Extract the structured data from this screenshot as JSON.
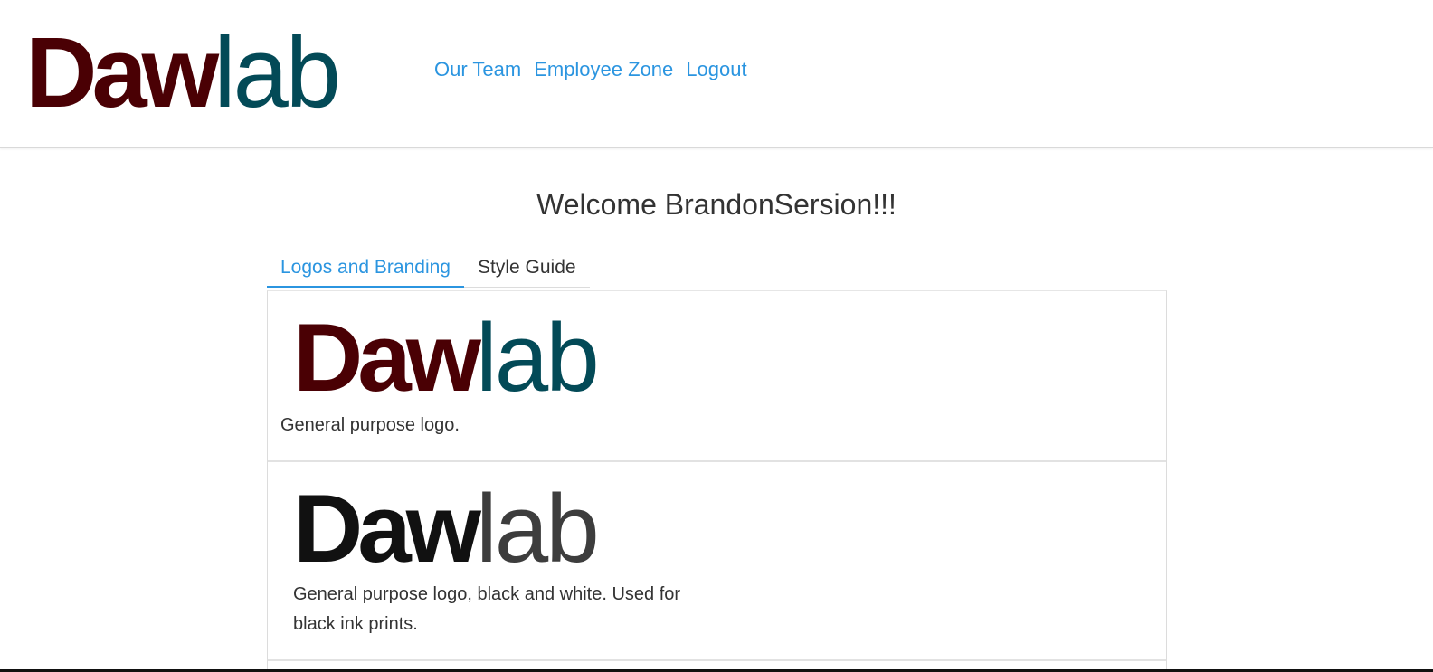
{
  "header": {
    "logo": {
      "part1": "Daw",
      "part2": "lab"
    },
    "nav": [
      "Our Team",
      "Employee Zone",
      "Logout"
    ]
  },
  "welcome": "Welcome BrandonSersion!!!",
  "tabs": [
    {
      "label": "Logos and Branding",
      "active": true
    },
    {
      "label": "Style Guide",
      "active": false
    }
  ],
  "cards": [
    {
      "logo": {
        "part1": "Daw",
        "part2": "lab"
      },
      "caption": "General purpose logo."
    },
    {
      "logo": {
        "part1": "Daw",
        "part2": "lab"
      },
      "caption": "General purpose logo, black and white. Used for black ink prints."
    }
  ],
  "colors": {
    "brand_dark_red": "#4a0004",
    "brand_teal": "#034a57",
    "link_blue": "#2b95e0",
    "bw_black": "#111111",
    "bw_gray": "#3d3d3d"
  }
}
